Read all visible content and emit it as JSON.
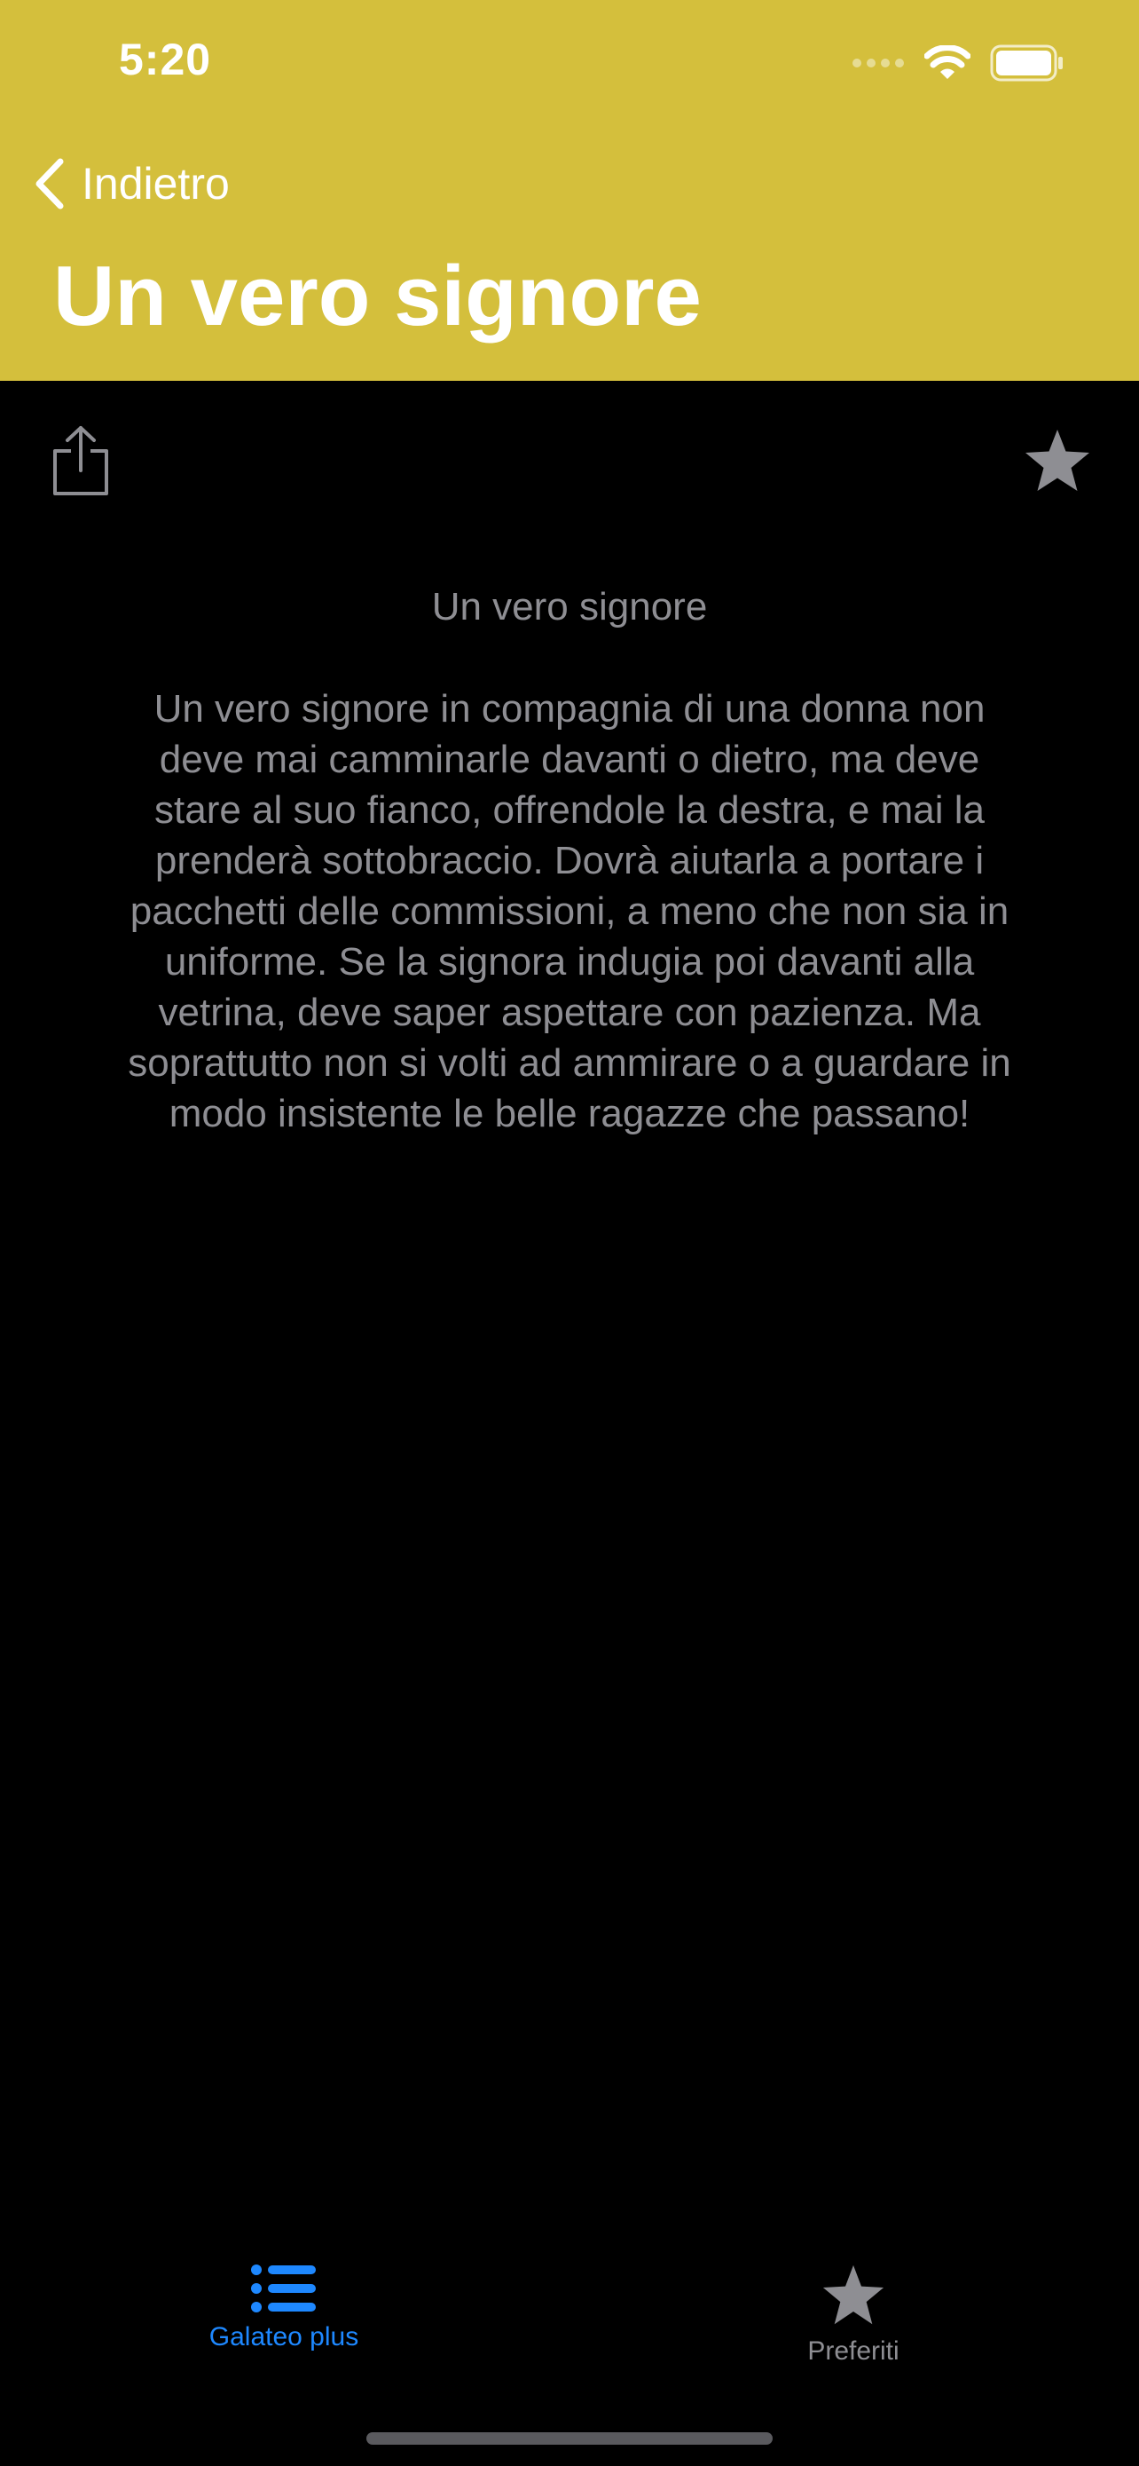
{
  "status_bar": {
    "time": "5:20"
  },
  "nav": {
    "back_label": "Indietro",
    "title": "Un vero signore"
  },
  "article": {
    "heading": "Un vero signore",
    "body": "Un vero signore in compagnia di una donna non deve mai camminarle davanti o dietro, ma deve stare al suo fianco, offrendole la destra, e mai la prenderà sottobraccio. Dovrà aiutarla a portare i pacchetti delle commissioni, a meno che non sia in uniforme. Se la signora indugia poi davanti alla vetrina, deve saper aspettare con pazienza. Ma soprattutto non si volti ad ammirare o a guardare in modo insistente le belle ragazze che passano!"
  },
  "tabs": [
    {
      "label": "Galateo plus",
      "icon": "list-icon",
      "selected": true
    },
    {
      "label": "Preferiti",
      "icon": "star-icon",
      "selected": false
    }
  ],
  "colors": {
    "header_bg": "#D4BF3C",
    "background": "#000000",
    "text_muted": "#8E8E93",
    "accent_blue": "#1E88FF",
    "icon_gray": "#8E8E93"
  }
}
